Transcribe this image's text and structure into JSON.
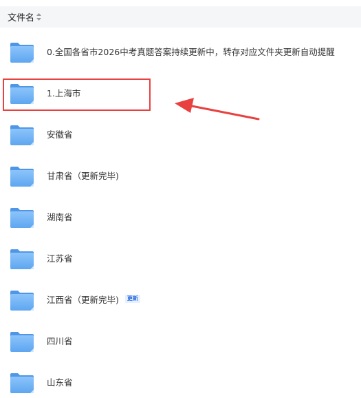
{
  "header": {
    "column_label": "文件名"
  },
  "files": [
    {
      "name": "0.全国各省市2026中考真题答案持续更新中，转存对应文件夹更新自动提醒",
      "badge": ""
    },
    {
      "name": "1.上海市",
      "badge": ""
    },
    {
      "name": "安徽省",
      "badge": ""
    },
    {
      "name": "甘肃省（更新完毕)",
      "badge": ""
    },
    {
      "name": "湖南省",
      "badge": ""
    },
    {
      "name": "江苏省",
      "badge": ""
    },
    {
      "name": "江西省（更新完毕)",
      "badge": "更新"
    },
    {
      "name": "四川省",
      "badge": ""
    },
    {
      "name": "山东省",
      "badge": ""
    }
  ],
  "icons": {
    "folder": "folder-icon",
    "sort": "sort-icon"
  },
  "colors": {
    "folder": "#6aaef5",
    "highlight": "#e8413f",
    "badge_text": "#2b6be0",
    "badge_bg": "#e6f0ff",
    "header_bg": "#f5f6f8"
  }
}
